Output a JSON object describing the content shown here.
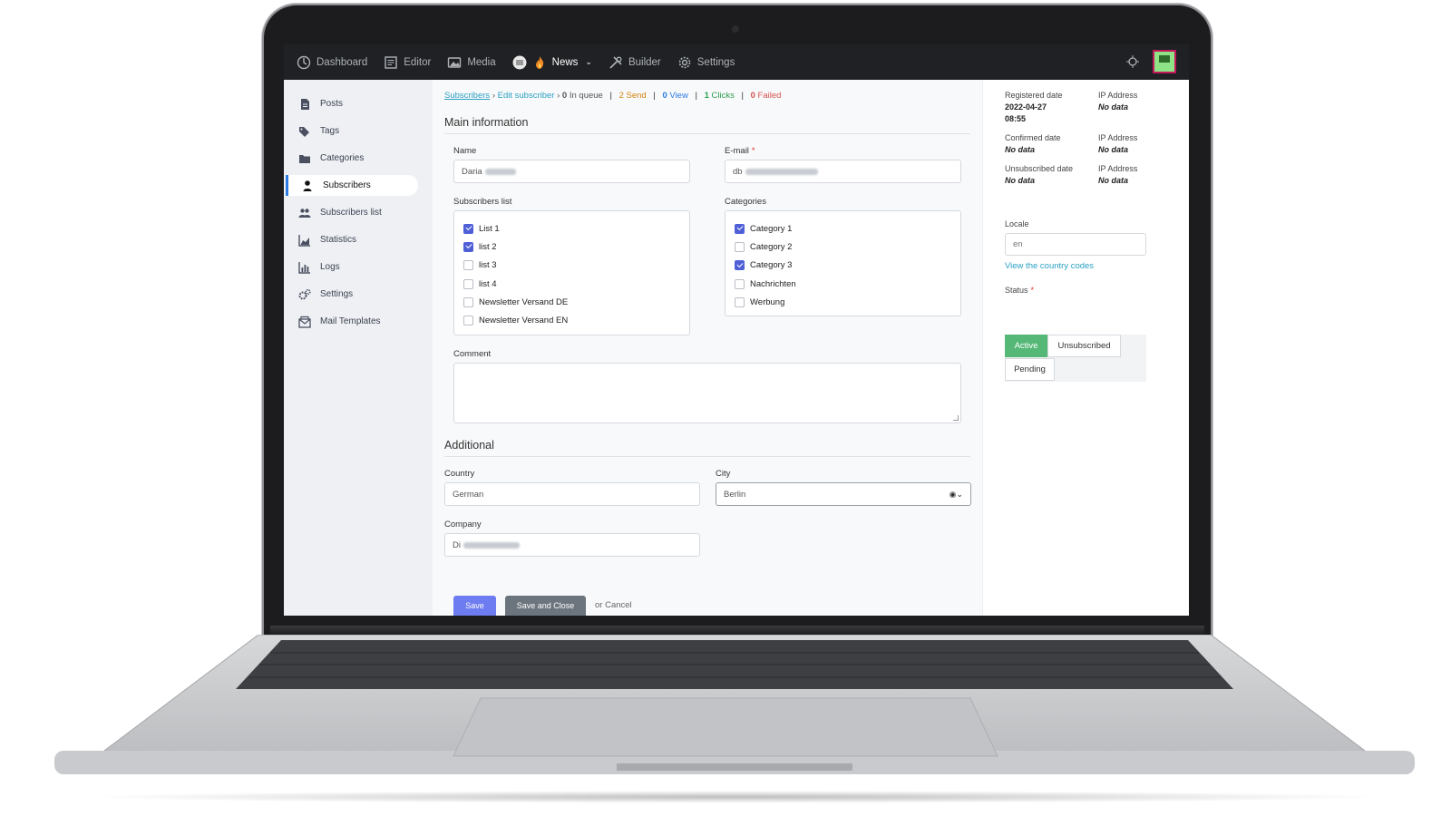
{
  "topbar": {
    "items": [
      {
        "label": "Dashboard",
        "icon": "dashboard-icon"
      },
      {
        "label": "Editor",
        "icon": "editor-icon"
      },
      {
        "label": "Media",
        "icon": "media-icon"
      },
      {
        "label": "News",
        "icon": "fire-icon"
      },
      {
        "label": "Builder",
        "icon": "tools-icon"
      },
      {
        "label": "Settings",
        "icon": "gear-icon"
      }
    ]
  },
  "sidebar": {
    "items": [
      {
        "label": "Posts"
      },
      {
        "label": "Tags"
      },
      {
        "label": "Categories"
      },
      {
        "label": "Subscribers"
      },
      {
        "label": "Subscribers list"
      },
      {
        "label": "Statistics"
      },
      {
        "label": "Logs"
      },
      {
        "label": "Settings"
      },
      {
        "label": "Mail Templates"
      }
    ],
    "active": "Subscribers"
  },
  "breadcrumb": {
    "root": "Subscribers",
    "current": "Edit subscriber",
    "in_queue_count": "0",
    "in_queue_label": "In queue",
    "send_count": "2",
    "send_label": "Send",
    "view_count": "0",
    "view_label": "View",
    "clicks_count": "1",
    "clicks_label": "Clicks",
    "failed_count": "0",
    "failed_label": "Failed"
  },
  "main_info": {
    "title": "Main information",
    "name_label": "Name",
    "name_value": "Daria",
    "email_label": "E-mail",
    "email_value": "db",
    "subscribers_list_label": "Subscribers list",
    "subscribers_lists": [
      {
        "label": "List 1",
        "checked": true
      },
      {
        "label": "list 2",
        "checked": true
      },
      {
        "label": "list 3",
        "checked": false
      },
      {
        "label": "list 4",
        "checked": false
      },
      {
        "label": "Newsletter Versand DE",
        "checked": false
      },
      {
        "label": "Newsletter Versand EN",
        "checked": false
      }
    ],
    "categories_label": "Categories",
    "categories": [
      {
        "label": "Category 1",
        "checked": true
      },
      {
        "label": "Category 2",
        "checked": false
      },
      {
        "label": "Category 3",
        "checked": true
      },
      {
        "label": "Nachrichten",
        "checked": false
      },
      {
        "label": "Werbung",
        "checked": false
      }
    ],
    "comment_label": "Comment",
    "comment_value": ""
  },
  "additional": {
    "title": "Additional",
    "country_label": "Country",
    "country_value": "German",
    "city_label": "City",
    "city_value": "Berlin",
    "company_label": "Company",
    "company_value": "Di"
  },
  "actions": {
    "save": "Save",
    "save_close": "Save and Close",
    "cancel": "or Cancel"
  },
  "meta": {
    "registered_label": "Registered date",
    "registered_value": "2022-04-27 08:55",
    "confirmed_label": "Confirmed date",
    "confirmed_value": "No data",
    "unsubscribed_label": "Unsubscribed date",
    "unsubscribed_value": "No data",
    "ip_label": "IP Address",
    "ip_value": "No data"
  },
  "locale": {
    "label": "Locale",
    "placeholder": "en",
    "link": "View the country codes"
  },
  "status": {
    "label": "Status",
    "options": [
      "Active",
      "Unsubscribed",
      "Pending"
    ],
    "selected": "Active"
  },
  "colors": {
    "accent": "#2c7be5",
    "active_status": "#56b877",
    "save_button": "#6d7cf0"
  }
}
